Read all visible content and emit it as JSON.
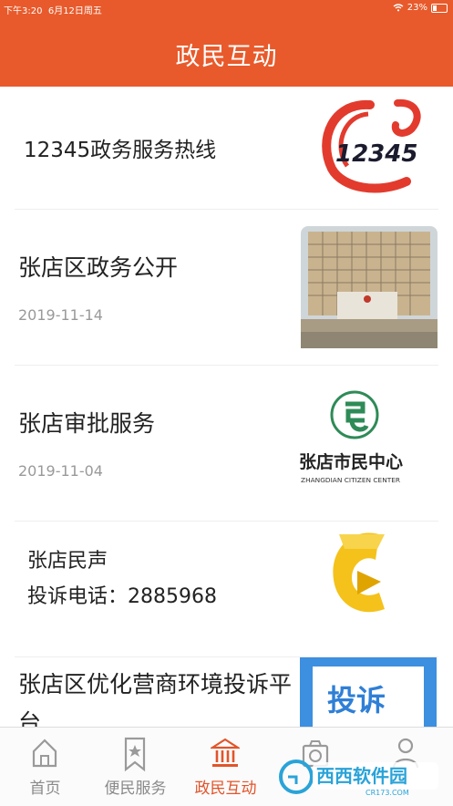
{
  "status_bar": {
    "time": "下午3:20",
    "date": "6月12日周五",
    "battery": "23%"
  },
  "header": {
    "title": "政民互动"
  },
  "items": [
    {
      "title": "12345政务服务热线",
      "logo_text": "12345"
    },
    {
      "title": "张店区政务公开",
      "date": "2019-11-14"
    },
    {
      "title": "张店审批服务",
      "date": "2019-11-04",
      "logo_title": "张店市民中心",
      "logo_sub": "ZHANGDIAN CITIZEN CENTER"
    },
    {
      "title_line1": "张店民声",
      "title_line2": "投诉电话：2885968"
    },
    {
      "title_line1": "张店区优化营商环境投诉平",
      "title_line2": "台",
      "badge": "投诉"
    }
  ],
  "tabs": [
    {
      "label": "首页",
      "icon": "home-icon"
    },
    {
      "label": "便民服务",
      "icon": "bookmark-star-icon"
    },
    {
      "label": "政民互动",
      "icon": "government-building-icon",
      "active": true
    },
    {
      "label": "",
      "icon": "camera-icon"
    },
    {
      "label": "",
      "icon": "person-icon"
    }
  ],
  "watermark": {
    "text": "西西软件园",
    "url": "CR173.COM"
  },
  "colors": {
    "brand": "#e85a2b",
    "active_tab": "#e2542a"
  }
}
